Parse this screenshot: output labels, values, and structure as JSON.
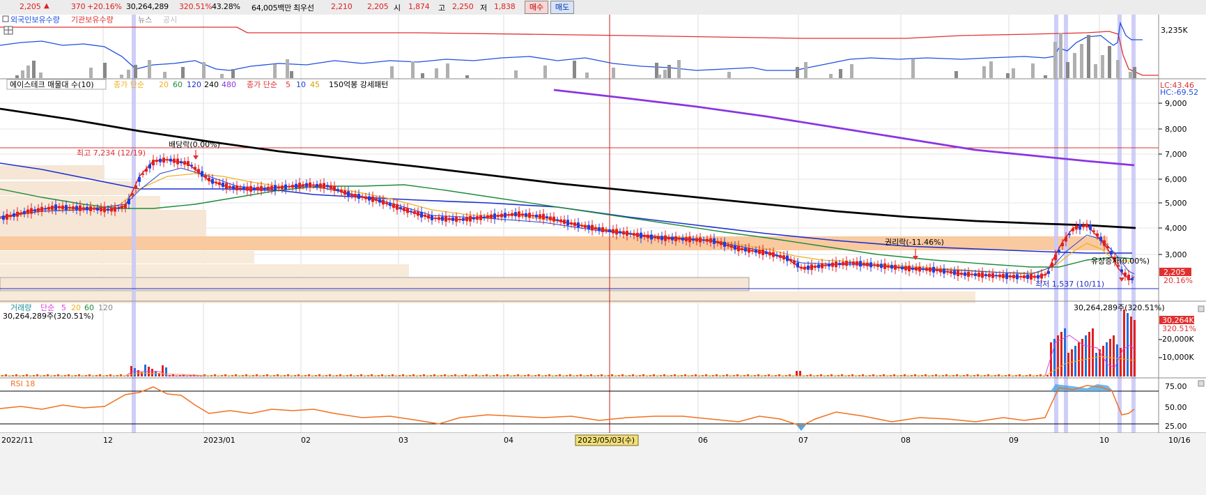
{
  "ticker": {
    "price": "2,205",
    "up_arrow": "▲",
    "change": "370",
    "change_pct": "+20.16%",
    "volume": "30,264,289",
    "volume_ratio": "320.51%",
    "turnover_rate": "43.28%",
    "trade_value": "64,005백만",
    "priority_label": "최우선",
    "ask": "2,210",
    "bid": "2,205",
    "open_label": "시",
    "open": "1,874",
    "high_label": "고",
    "high": "2,250",
    "low_label": "저",
    "low": "1,838",
    "buy_button": "매수",
    "sell_button": "매도"
  },
  "panel_ownership": {
    "legend": [
      "외국인보유수량",
      "기관보유수량",
      "뉴스",
      "공시"
    ],
    "right_value": "3,235K",
    "colors": {
      "foreign": "#1f4fe0",
      "institution": "#e03030",
      "news": "#a8a8a8",
      "disclosure": "#c8c8c8"
    }
  },
  "panel_price": {
    "legend": [
      "에이스테크 매물대 수(10)",
      "종가 단순",
      "20",
      "60",
      "120",
      "240",
      "480",
      "종가 단순",
      "5",
      "10",
      "45",
      "150억봉 강세패턴"
    ],
    "right_top_1": "LC:43.46",
    "right_top_2": "HC:-69.52",
    "y_ticks": [
      "9,000",
      "8,000",
      "7,000",
      "6,000",
      "5,000",
      "4,000",
      "3,000"
    ],
    "current_price_box": "2,205",
    "current_pct": "20.16%",
    "annotations": {
      "high": "최고 7,234 (12/19)",
      "dividend": "배당락(0.00%)",
      "rights": "권리락(-11.46%)",
      "paid_in": "유상증자(0.00%)",
      "low": "최저 1,537 (10/11)"
    }
  },
  "panel_volume": {
    "legend": [
      "거래량",
      "단순",
      "5",
      "20",
      "60",
      "120"
    ],
    "left_value": "30,264,289주(320.51%)",
    "top_right_value": "30,264,289주(320.51%)",
    "right_box": "30,264K",
    "right_pct": "320.51%",
    "y_ticks": [
      "20,000K",
      "10,000K"
    ]
  },
  "panel_rsi": {
    "legend": "RSI 18",
    "y_ticks": [
      "75.00",
      "50.00",
      "25.00"
    ]
  },
  "x_axis": {
    "labels": [
      "2022/11",
      "12",
      "2023/01",
      "02",
      "03",
      "04",
      "2023/05/03(수)",
      "06",
      "07",
      "08",
      "09",
      "10",
      "10/16"
    ]
  },
  "chart_data": {
    "type": "candlestick",
    "price_range": [
      1537,
      7234
    ],
    "price_points": [
      {
        "date": "2022-11",
        "close": 4500
      },
      {
        "date": "2022-12",
        "close": 5000
      },
      {
        "date": "2022-12-19",
        "close": 7234
      },
      {
        "date": "2023-01",
        "close": 5800
      },
      {
        "date": "2023-02",
        "close": 5600
      },
      {
        "date": "2023-03",
        "close": 4300
      },
      {
        "date": "2023-04",
        "close": 4600
      },
      {
        "date": "2023-05",
        "close": 3800
      },
      {
        "date": "2023-06",
        "close": 3600
      },
      {
        "date": "2023-07",
        "close": 2400
      },
      {
        "date": "2023-08",
        "close": 2500
      },
      {
        "date": "2023-09",
        "close": 2000
      },
      {
        "date": "2023-09-25",
        "close": 4200
      },
      {
        "date": "2023-10-11",
        "close": 1537
      },
      {
        "date": "2023-10-16",
        "close": 2205
      }
    ],
    "rsi_range": [
      25,
      75
    ]
  }
}
